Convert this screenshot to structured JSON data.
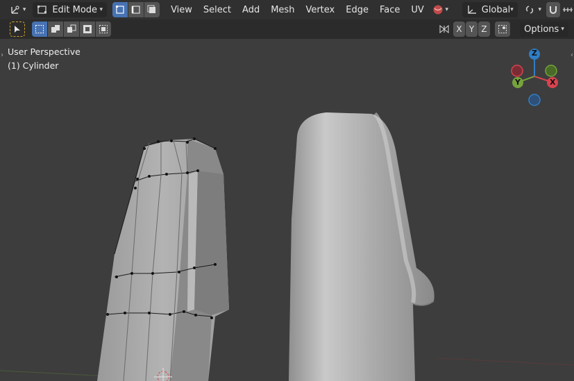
{
  "header": {
    "mode_label": "Edit Mode",
    "menus": [
      "View",
      "Select",
      "Add",
      "Mesh",
      "Vertex",
      "Edge",
      "Face",
      "UV"
    ],
    "transform_orientation": "Global"
  },
  "toolbar": {
    "axes": [
      "X",
      "Y",
      "Z"
    ],
    "options_label": "Options"
  },
  "viewport": {
    "view_name": "User Perspective",
    "object_label": "(1) Cylinder"
  },
  "gizmo": {
    "z": "Z",
    "y": "Y",
    "x": "X",
    "colors": {
      "x": "#d9434f",
      "y": "#75a33c",
      "z": "#2f7ec7"
    }
  },
  "icons": {
    "editor_type": "axis-editor-icon",
    "select_box": "select-box-icon",
    "shading": "shading-sphere-icon",
    "snap": "magnet-icon",
    "proportional": "proportional-edit-icon"
  }
}
